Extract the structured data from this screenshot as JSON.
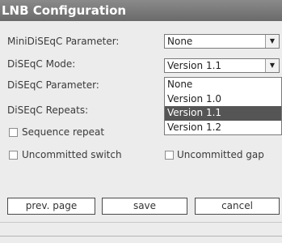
{
  "dialog": {
    "title": "LNB Configuration"
  },
  "fields": {
    "minidiseqc_label": "MiniDiSEqC Parameter:",
    "minidiseqc_value": "None",
    "diseqc_mode_label": "DiSEqC Mode:",
    "diseqc_mode_value": "Version 1.1",
    "diseqc_param_label": "DiSEqC Parameter:",
    "diseqc_repeats_label": "DiSEqC Repeats:"
  },
  "dropdown": {
    "options": [
      "None",
      "Version 1.0",
      "Version 1.1",
      "Version 1.2"
    ],
    "selected": "Version 1.1"
  },
  "checkboxes": {
    "sequence_repeat": "Sequence repeat",
    "uncommitted_switch": "Uncommitted switch",
    "uncommitted_gap": "Uncommitted gap"
  },
  "buttons": {
    "prev_page": "prev. page",
    "save": "save",
    "cancel": "cancel"
  },
  "icons": {
    "dropdown_arrow": "chevron-down-icon"
  }
}
